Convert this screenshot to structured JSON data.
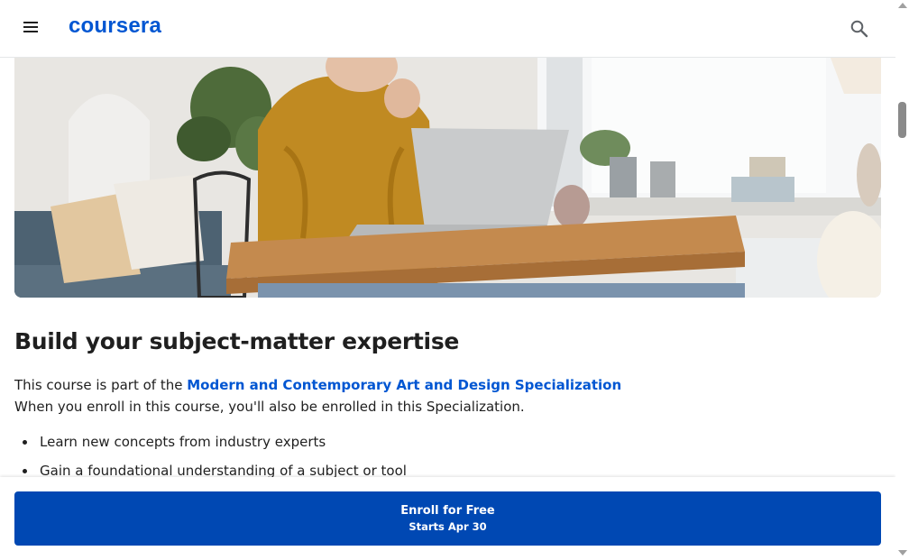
{
  "header": {
    "logo_text": "coursera",
    "menu_icon": "hamburger-menu-icon",
    "search_icon": "search-icon"
  },
  "hero": {
    "image_alt": "Woman in mustard sweater working on a laptop at a wooden table"
  },
  "section": {
    "title": "Build your subject-matter expertise",
    "intro_prefix": "This course is part of the ",
    "specialization_link": "Modern and Contemporary Art and Design Specialization",
    "intro_line2": "When you enroll in this course, you'll also be enrolled in this Specialization.",
    "bullets": [
      "Learn new concepts from industry experts",
      "Gain a foundational understanding of a subject or tool"
    ]
  },
  "enroll": {
    "label": "Enroll for Free",
    "sublabel": "Starts Apr 30"
  },
  "colors": {
    "brand": "#0056d2",
    "button": "#0048b3"
  }
}
